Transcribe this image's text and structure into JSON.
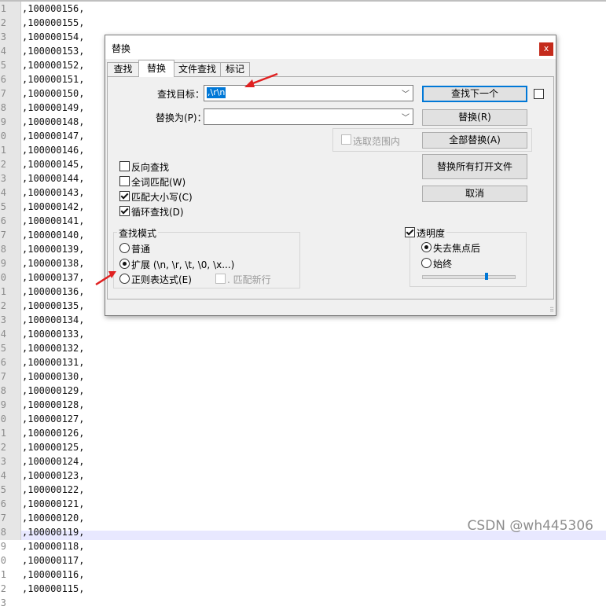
{
  "editor": {
    "lines": [
      {
        "n": "1",
        "t": ",100000156,"
      },
      {
        "n": "2",
        "t": ",100000155,"
      },
      {
        "n": "3",
        "t": ",100000154,"
      },
      {
        "n": "4",
        "t": ",100000153,"
      },
      {
        "n": "5",
        "t": ",100000152,"
      },
      {
        "n": "6",
        "t": ",100000151,"
      },
      {
        "n": "7",
        "t": ",100000150,"
      },
      {
        "n": "8",
        "t": ",100000149,"
      },
      {
        "n": "9",
        "t": ",100000148,"
      },
      {
        "n": "0",
        "t": ",100000147,"
      },
      {
        "n": "1",
        "t": ",100000146,"
      },
      {
        "n": "2",
        "t": ",100000145,"
      },
      {
        "n": "3",
        "t": ",100000144,"
      },
      {
        "n": "4",
        "t": ",100000143,"
      },
      {
        "n": "5",
        "t": ",100000142,"
      },
      {
        "n": "6",
        "t": ",100000141,"
      },
      {
        "n": "7",
        "t": ",100000140,"
      },
      {
        "n": "8",
        "t": ",100000139,"
      },
      {
        "n": "9",
        "t": ",100000138,"
      },
      {
        "n": "0",
        "t": ",100000137,"
      },
      {
        "n": "1",
        "t": ",100000136,"
      },
      {
        "n": "2",
        "t": ",100000135,"
      },
      {
        "n": "3",
        "t": ",100000134,"
      },
      {
        "n": "4",
        "t": ",100000133,"
      },
      {
        "n": "5",
        "t": ",100000132,"
      },
      {
        "n": "6",
        "t": ",100000131,"
      },
      {
        "n": "7",
        "t": ",100000130,"
      },
      {
        "n": "8",
        "t": ",100000129,"
      },
      {
        "n": "9",
        "t": ",100000128,"
      },
      {
        "n": "0",
        "t": ",100000127,"
      },
      {
        "n": "1",
        "t": ",100000126,"
      },
      {
        "n": "2",
        "t": ",100000125,"
      },
      {
        "n": "3",
        "t": ",100000124,"
      },
      {
        "n": "4",
        "t": ",100000123,"
      },
      {
        "n": "5",
        "t": ",100000122,"
      },
      {
        "n": "6",
        "t": ",100000121,"
      },
      {
        "n": "7",
        "t": ",100000120,"
      },
      {
        "n": "8",
        "t": ",100000119,"
      },
      {
        "n": "9",
        "t": ",100000118,"
      },
      {
        "n": "0",
        "t": ",100000117,"
      },
      {
        "n": "1",
        "t": ",100000116,"
      },
      {
        "n": "2",
        "t": ",100000115,"
      },
      {
        "n": "3",
        "t": ""
      }
    ]
  },
  "watermark": "CSDN @wh445306",
  "dialog": {
    "title": "替换",
    "close_glyph": "x",
    "tabs": [
      "查找",
      "替换",
      "文件查找",
      "标记"
    ],
    "find_label": "查找目标：",
    "find_value": ",\\r\\n",
    "replace_label": "替换为(P)：",
    "replace_value": "",
    "combo_arrow": "﹀",
    "in_selection_label": "选取范围内",
    "buttons": {
      "find_next": "查找下一个",
      "replace": "替换(R)",
      "replace_all": "全部替换(A)",
      "replace_all_open": "替换所有打开文件",
      "cancel": "取消"
    },
    "options": {
      "backward": "反向查找",
      "whole_word": "全词匹配(W)",
      "match_case": "匹配大小写(C)",
      "wrap_around": "循环查找(D)"
    },
    "search_mode": {
      "title": "查找模式",
      "normal": "普通",
      "extended": "扩展 (\\n, \\r, \\t, \\0, \\x...)",
      "regex": "正则表达式(E)",
      "dot_newline": ". 匹配新行"
    },
    "transparency": {
      "title": "透明度",
      "on_lose_focus": "失去焦点后",
      "always": "始终",
      "level": 0.7
    },
    "grip_glyph": "⠿"
  },
  "colors": {
    "annotation_arrow": "#e02020",
    "accent": "#0078d7"
  }
}
